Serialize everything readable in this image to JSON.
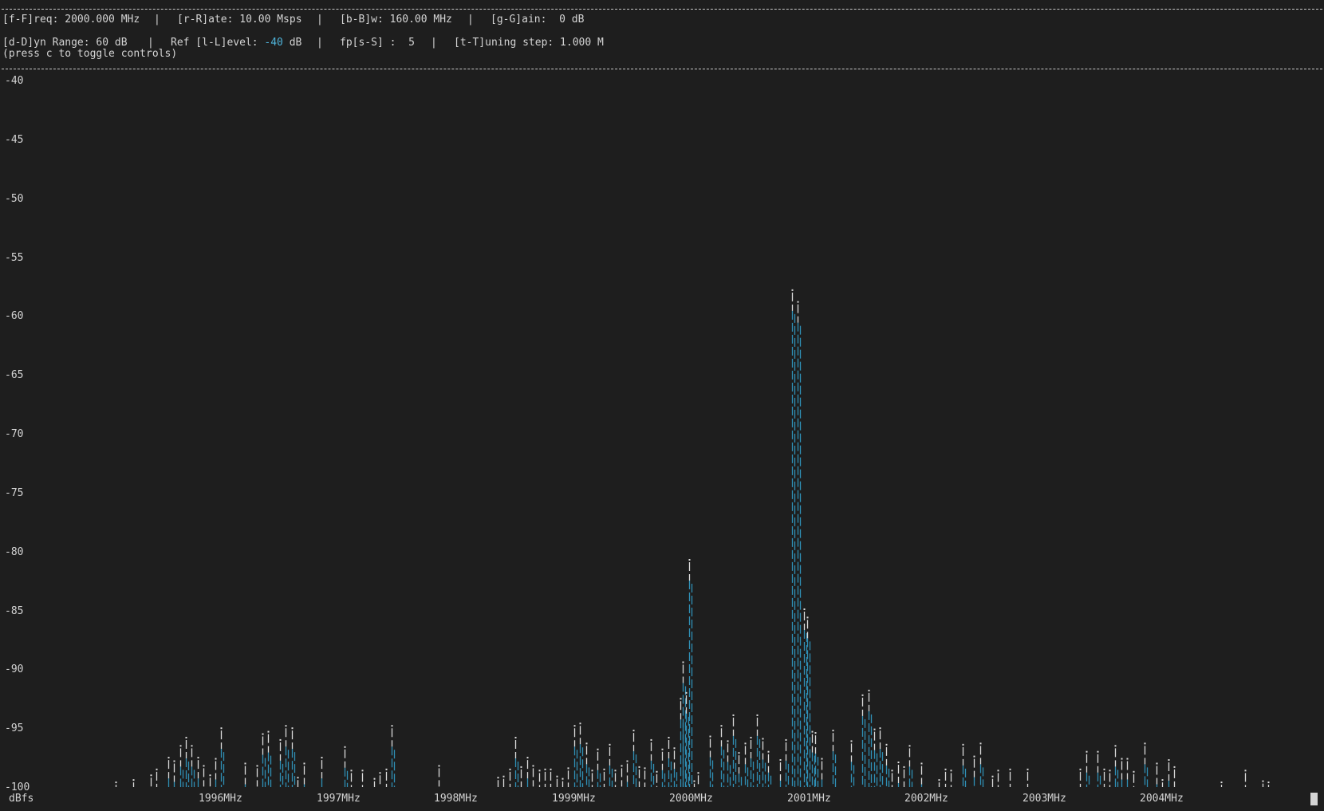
{
  "controls": {
    "line1": {
      "freq": "[f-F]req: 2000.000 MHz",
      "rate": "[r-R]ate: 10.00 Msps",
      "bw": "[b-B]w: 160.00 MHz",
      "gain": "[g-G]ain:  0 dB",
      "sep": "|"
    },
    "line2": {
      "dyn_range": "[d-D]yn Range: 60 dB",
      "ref_prefix": "Ref [l-L]evel: ",
      "ref_value": "-40",
      "ref_suffix": " dB",
      "fps": "fp[s-S] :  5",
      "tuning": "[t-T]uning step: 1.000 M",
      "sep": "|"
    },
    "hint": "(press c to toggle controls)"
  },
  "colors": {
    "background": "#1e1e1e",
    "text": "#d4d4d4",
    "bar_cyan": "#2f8fb5",
    "bar_white": "#dcdcdc",
    "highlight": "#4fb3d9"
  },
  "chart_data": {
    "type": "bar",
    "ylabel": "dBfs",
    "ylim": [
      -100,
      -40
    ],
    "y_ticks": [
      "-40",
      "-45",
      "-50",
      "-55",
      "-60",
      "-65",
      "-70",
      "-75",
      "-80",
      "-85",
      "-90",
      "-95",
      "-100"
    ],
    "x_ticks": [
      {
        "label": "1996MHz",
        "value": 1996
      },
      {
        "label": "1997MHz",
        "value": 1997
      },
      {
        "label": "1998MHz",
        "value": 1998
      },
      {
        "label": "1999MHz",
        "value": 1999
      },
      {
        "label": "2000MHz",
        "value": 2000
      },
      {
        "label": "2001MHz",
        "value": 2001
      },
      {
        "label": "2002MHz",
        "value": 2002
      },
      {
        "label": "2003MHz",
        "value": 2003
      },
      {
        "label": "2004MHz",
        "value": 2004
      }
    ],
    "xlim": [
      1994.9,
      2005.0
    ],
    "series": [
      {
        "freq_mhz": [
          1995.1,
          1995.25,
          1995.4,
          1995.45,
          1995.55,
          1995.6,
          1995.65,
          1995.7,
          1995.75,
          1995.8,
          1995.85,
          1995.9,
          1995.95,
          1996.0,
          1996.2,
          1996.3,
          1996.35,
          1996.4,
          1996.5,
          1996.55,
          1996.6,
          1996.65,
          1996.7,
          1996.85,
          1997.05,
          1997.1,
          1997.2,
          1997.3,
          1997.35,
          1997.4,
          1997.45,
          1997.85,
          1998.35,
          1998.4,
          1998.45,
          1998.5,
          1998.55,
          1998.6,
          1998.65,
          1998.7,
          1998.75,
          1998.8,
          1998.85,
          1998.9,
          1998.95,
          1999.0,
          1999.05,
          1999.1,
          1999.15,
          1999.2,
          1999.25,
          1999.3,
          1999.35,
          1999.4,
          1999.45,
          1999.5,
          1999.55,
          1999.6,
          1999.65,
          1999.7,
          1999.75,
          1999.8,
          1999.85,
          1999.9,
          1999.92,
          1999.95,
          1999.98,
          2000.02,
          2000.05,
          2000.15,
          2000.25,
          2000.3,
          2000.35,
          2000.4,
          2000.45,
          2000.5,
          2000.55,
          2000.6,
          2000.65,
          2000.75,
          2000.8,
          2000.85,
          2000.9,
          2000.95,
          2000.98,
          2001.02,
          2001.05,
          2001.1,
          2001.2,
          2001.35,
          2001.45,
          2001.5,
          2001.55,
          2001.6,
          2001.65,
          2001.7,
          2001.75,
          2001.8,
          2001.85,
          2001.95,
          2002.1,
          2002.15,
          2002.2,
          2002.3,
          2002.4,
          2002.45,
          2002.55,
          2002.6,
          2002.7,
          2002.85,
          2003.3,
          2003.35,
          2003.45,
          2003.5,
          2003.55,
          2003.6,
          2003.65,
          2003.7,
          2003.75,
          2003.85,
          2003.95,
          2004.0,
          2004.05,
          2004.1,
          2004.5,
          2004.7,
          2004.85,
          2004.9
        ],
        "level_db": [
          -99.6,
          -99.4,
          -99.0,
          -98.5,
          -97.5,
          -97.8,
          -96.5,
          -95.8,
          -96.5,
          -97.5,
          -98.2,
          -99.0,
          -97.6,
          -95.0,
          -98.0,
          -98.2,
          -95.5,
          -95.3,
          -96.0,
          -94.8,
          -95.0,
          -99.2,
          -98.0,
          -97.5,
          -96.6,
          -98.6,
          -98.6,
          -99.3,
          -98.8,
          -98.5,
          -94.8,
          -98.2,
          -99.2,
          -99.1,
          -98.5,
          -95.8,
          -98.3,
          -97.5,
          -98.2,
          -98.6,
          -98.5,
          -98.5,
          -99.1,
          -99.3,
          -98.4,
          -94.8,
          -94.6,
          -96.3,
          -98.6,
          -96.8,
          -98.5,
          -96.4,
          -98.6,
          -98.2,
          -97.8,
          -95.2,
          -98.3,
          -98.4,
          -96.0,
          -98.7,
          -96.8,
          -95.8,
          -96.7,
          -92.5,
          -89.4,
          -92.0,
          -80.7,
          -99.5,
          -98.8,
          -95.7,
          -94.8,
          -96.1,
          -93.9,
          -97.1,
          -96.3,
          -95.8,
          -93.9,
          -95.9,
          -97.0,
          -97.7,
          -96.0,
          -57.8,
          -58.8,
          -84.9,
          -85.6,
          -95.3,
          -95.4,
          -97.6,
          -95.2,
          -96.1,
          -92.2,
          -91.8,
          -95.1,
          -95.0,
          -96.4,
          -98.6,
          -97.9,
          -98.3,
          -96.5,
          -98.0,
          -99.4,
          -98.5,
          -98.6,
          -96.4,
          -97.4,
          -96.3,
          -99.1,
          -98.6,
          -98.5,
          -98.5,
          -98.5,
          -97.0,
          -97.0,
          -98.5,
          -98.6,
          -96.5,
          -97.6,
          -97.6,
          -98.7,
          -96.3,
          -98.0,
          -99.4,
          -97.7,
          -98.3,
          -99.6,
          -98.6,
          -99.5,
          -99.6
        ]
      }
    ]
  }
}
